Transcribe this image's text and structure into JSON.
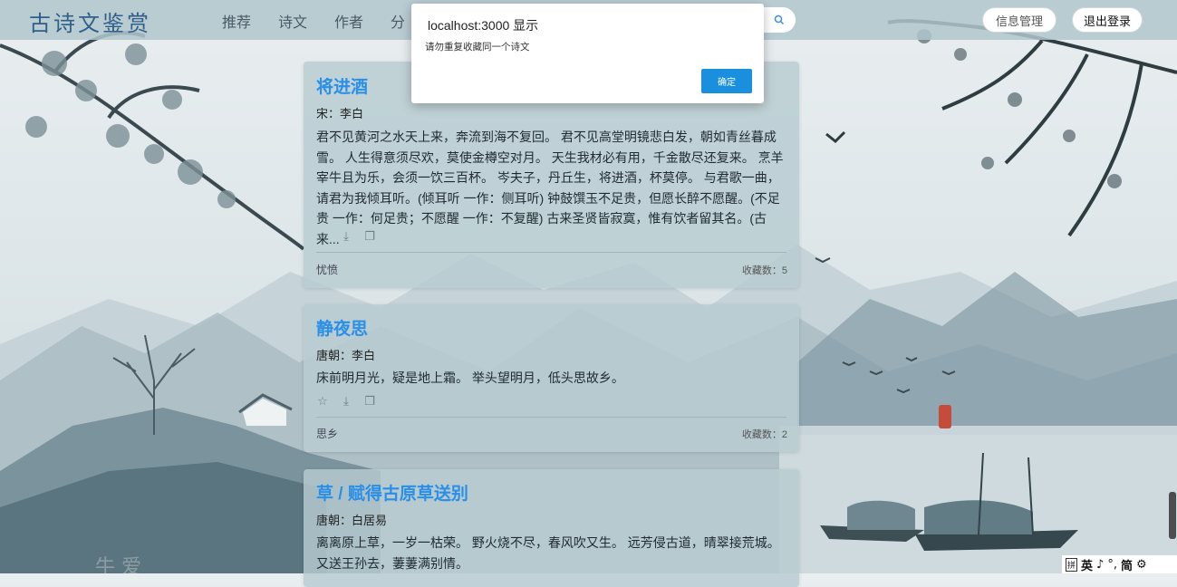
{
  "header": {
    "logo": "古诗文鉴赏",
    "nav": [
      "推荐",
      "诗文",
      "作者",
      "分"
    ],
    "info_button": "信息管理",
    "logout_button": "退出登录"
  },
  "dialog": {
    "title": "localhost:3000 显示",
    "message": "请勿重复收藏同一个诗文",
    "ok_label": "确定"
  },
  "poems": [
    {
      "title": "将进酒",
      "author": "宋：李白",
      "lines": [
        "君不见黄河之水天上来，奔流到海不复回。 君不见高堂明镜悲白发，朝如青丝暮成",
        "雪。 人生得意须尽欢，莫使金樽空对月。 天生我材必有用，千金散尽还复来。 烹羊",
        "宰牛且为乐，会须一饮三百杯。 岑夫子，丹丘生，将进酒，杯莫停。 与君歌一曲，",
        "请君为我倾耳听。(倾耳听 一作：侧耳听) 钟鼓馔玉不足贵，但愿长醉不愿醒。(不足",
        "贵 一作：何足贵；不愿醒 一作：不复醒) 古来圣贤皆寂寞，惟有饮者留其名。(古来..."
      ],
      "tag": "忧愤",
      "count": "收藏数：5"
    },
    {
      "title": "静夜思",
      "author": "唐朝：李白",
      "lines": [
        "床前明月光，疑是地上霜。 举头望明月，低头思故乡。"
      ],
      "tag": "思乡",
      "count": "收藏数：2"
    },
    {
      "title": "草 / 赋得古原草送别",
      "author": "唐朝：白居易",
      "lines": [
        "离离原上草，一岁一枯荣。 野火烧不尽，春风吹又生。 远芳侵古道，晴翠接荒城。",
        "又送王孙去，萋萋满别情。"
      ]
    }
  ],
  "ime": {
    "label": "英",
    "mode": "简"
  },
  "icons": [
    "search-icon",
    "star-icon",
    "download-icon",
    "copy-icon"
  ]
}
